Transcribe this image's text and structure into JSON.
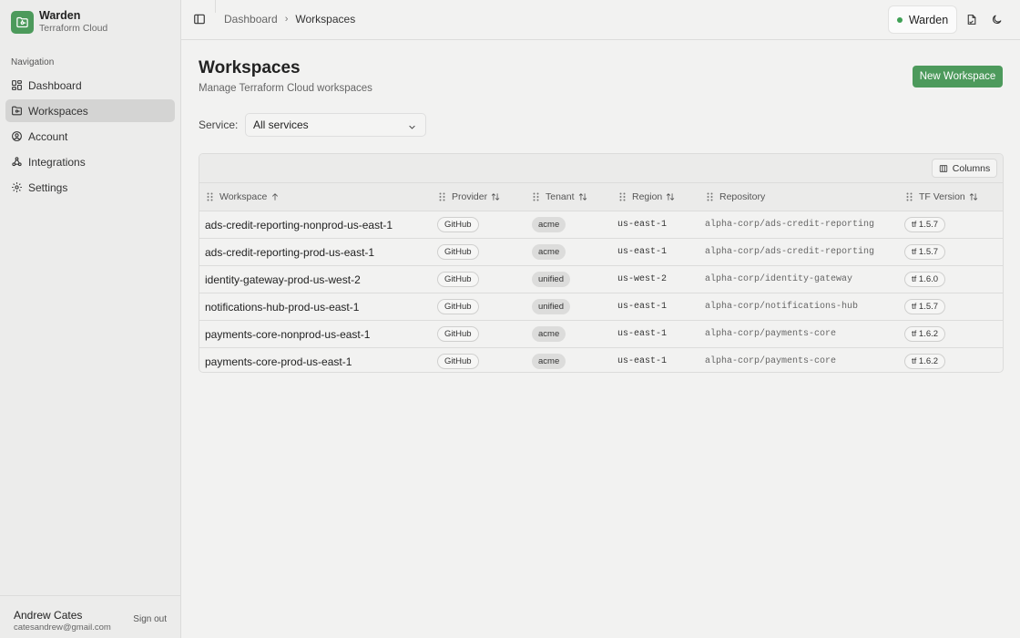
{
  "brand": {
    "title": "Warden",
    "subtitle": "Terraform Cloud"
  },
  "sidebar": {
    "heading": "Navigation",
    "items": [
      {
        "label": "Dashboard",
        "icon": "dashboard-icon"
      },
      {
        "label": "Workspaces",
        "icon": "folder-icon",
        "active": true
      },
      {
        "label": "Account",
        "icon": "user-circle-icon"
      },
      {
        "label": "Integrations",
        "icon": "webhook-icon"
      },
      {
        "label": "Settings",
        "icon": "gear-icon"
      }
    ],
    "user": {
      "name": "Andrew Cates",
      "email": "catesandrew@gmail.com",
      "signout": "Sign out"
    }
  },
  "header": {
    "breadcrumb": [
      "Dashboard",
      "Workspaces"
    ],
    "environment": "Warden",
    "status_color": "#3fa055"
  },
  "main": {
    "title": "Workspaces",
    "subtitle": "Manage Terraform Cloud workspaces",
    "new_button": "New Workspace",
    "filter": {
      "label": "Service:",
      "value": "All services"
    },
    "columns_button": "Columns",
    "table": {
      "headers": [
        "Workspace",
        "Provider",
        "Tenant",
        "Region",
        "Repository",
        "TF Version"
      ],
      "rows": [
        {
          "workspace": "ads-credit-reporting-nonprod-us-east-1",
          "provider": "GitHub",
          "tenant": "acme",
          "region": "us-east-1",
          "repository": "alpha-corp/ads-credit-reporting",
          "tf": "tf 1.5.7"
        },
        {
          "workspace": "ads-credit-reporting-prod-us-east-1",
          "provider": "GitHub",
          "tenant": "acme",
          "region": "us-east-1",
          "repository": "alpha-corp/ads-credit-reporting",
          "tf": "tf 1.5.7"
        },
        {
          "workspace": "identity-gateway-prod-us-west-2",
          "provider": "GitHub",
          "tenant": "unified",
          "region": "us-west-2",
          "repository": "alpha-corp/identity-gateway",
          "tf": "tf 1.6.0"
        },
        {
          "workspace": "notifications-hub-prod-us-east-1",
          "provider": "GitHub",
          "tenant": "unified",
          "region": "us-east-1",
          "repository": "alpha-corp/notifications-hub",
          "tf": "tf 1.5.7"
        },
        {
          "workspace": "payments-core-nonprod-us-east-1",
          "provider": "GitHub",
          "tenant": "acme",
          "region": "us-east-1",
          "repository": "alpha-corp/payments-core",
          "tf": "tf 1.6.2"
        },
        {
          "workspace": "payments-core-prod-us-east-1",
          "provider": "GitHub",
          "tenant": "acme",
          "region": "us-east-1",
          "repository": "alpha-corp/payments-core",
          "tf": "tf 1.6.2"
        }
      ]
    }
  },
  "colors": {
    "accent": "#4d9a5c",
    "sidebar_bg": "#ececeb",
    "page_bg": "#f2f2f1"
  }
}
